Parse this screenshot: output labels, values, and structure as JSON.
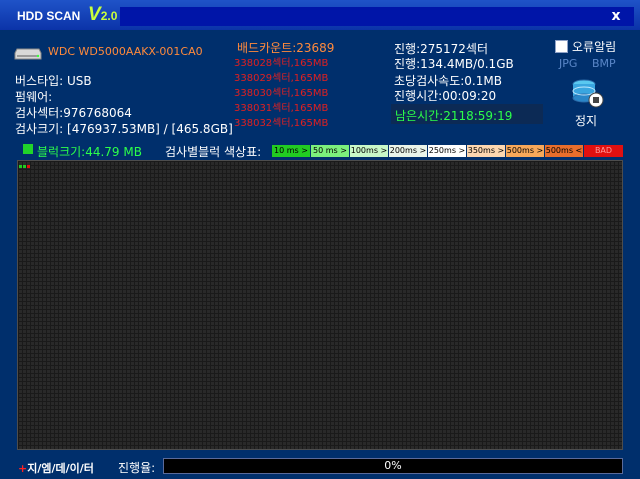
{
  "app": {
    "title": "HDD SCAN",
    "version_v": "V",
    "version_num": "2.0",
    "close_label": "x"
  },
  "drive": {
    "model": "WDC WD5000AAKX-001CA0",
    "bus_label": "버스타입: USB",
    "firmware_label": "펌웨어:",
    "sectors_label": "검사섹터:976768064",
    "size_label": "검사크기: [476937.53MB] / [465.8GB]"
  },
  "bad": {
    "title": "배드카운트:23689",
    "entries": [
      "338028섹터,165MB",
      "338029섹터,165MB",
      "338030섹터,165MB",
      "338031섹터,165MB",
      "338032섹터,165MB"
    ]
  },
  "progress_info": {
    "sector_progress": "진행:275172섹터",
    "size_progress": "진행:134.4MB/0.1GB",
    "speed": "초당검사속도:0.1MB",
    "elapsed": "진행시간:00:09:20",
    "remaining": "남은시간:2118:59:19"
  },
  "options": {
    "error_alarm_label": "오류알림",
    "error_alarm_checked": false,
    "jpg_label": "JPG",
    "bmp_label": "BMP",
    "stop_label": "정지",
    "stop_icon": "database-stop-icon"
  },
  "legend": {
    "block_size": "블럭크기:44.79 MB",
    "title": "검사별블럭 색상표:",
    "items": [
      {
        "label": "10 ms >",
        "color": "#22cc22"
      },
      {
        "label": "50 ms >",
        "color": "#7cf07c"
      },
      {
        "label": "100ms >",
        "color": "#c8f8c8"
      },
      {
        "label": "200ms >",
        "color": "#eaf4ea"
      },
      {
        "label": "250ms >",
        "color": "#ffffff"
      },
      {
        "label": "350ms >",
        "color": "#fdd7b0"
      },
      {
        "label": "500ms >",
        "color": "#f7a85a"
      },
      {
        "label": "500ms <",
        "color": "#e86e2c"
      },
      {
        "label": "BAD",
        "color": "#e01010"
      }
    ]
  },
  "scan_grid": {
    "scanned_blocks": [
      {
        "state": "10 ms >",
        "color": "#22cc22"
      },
      {
        "state": "10 ms >",
        "color": "#22cc22"
      },
      {
        "state": "BAD",
        "color": "#e01010"
      }
    ]
  },
  "status": {
    "logo": "지/엠/데/이/터",
    "logo_symbol": "+",
    "progress_label": "진행율:",
    "progress_text": "0%",
    "progress_value": 0
  }
}
